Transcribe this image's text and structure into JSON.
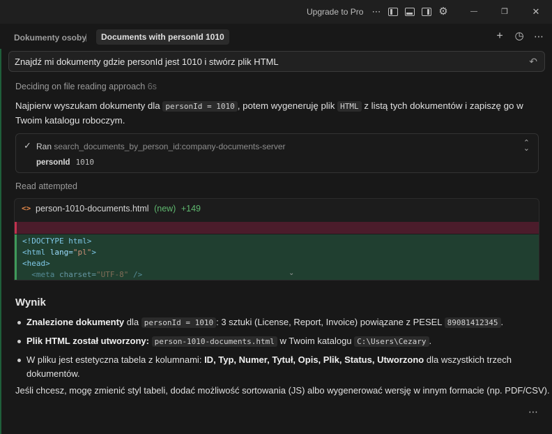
{
  "titlebar": {
    "upgrade_label": "Upgrade to Pro",
    "more_glyph": "⋯",
    "settings_glyph": "⚙",
    "minimize_glyph": "—",
    "restore_glyph": "❐",
    "close_glyph": "✕"
  },
  "header": {
    "tab_previous": "Dokumenty osoby",
    "tab_active": "Documents with personId 1010",
    "new_glyph": "+",
    "history_glyph": "◷",
    "more_glyph": "⋯"
  },
  "prompt": {
    "text": "Znajdź mi dokumenty gdzie personId jest 1010 i stwórz plik HTML",
    "undo_glyph": "↶"
  },
  "status": {
    "label": "Deciding on file reading approach",
    "time": "6s"
  },
  "intro": {
    "p1": "Najpierw wyszukam dokumenty dla",
    "code1": "personId = 1010",
    "p2": ", potem wygeneruję plik",
    "code2": "HTML",
    "p3": "z listą tych dokumentów i zapiszę go w Twoim katalogu roboczym."
  },
  "tool_call": {
    "check_glyph": "✓",
    "ran_label": "Ran",
    "tool_name": "search_documents_by_person_id:company-documents-server",
    "param_name": "personId",
    "param_value": "1010"
  },
  "read_attempted": "Read attempted",
  "file": {
    "icon_glyph": "<>",
    "name": "person-1010-documents.html",
    "status": "(new)",
    "additions": "+149",
    "lines": [
      {
        "tag": "<!DOCTYPE html>"
      },
      {
        "open": "<html ",
        "attr": "lang=",
        "val": "\"pl\"",
        "close": ">"
      },
      {
        "tag": "<head>"
      },
      {
        "open": "  <meta ",
        "attr": "charset=",
        "val": "\"UTF-8\"",
        "close": " />"
      }
    ],
    "chevron_glyph": "⌄"
  },
  "result": {
    "heading": "Wynik",
    "b1_bold": "Znalezione dokumenty",
    "b1_t1": "dla",
    "b1_code": "personId = 1010",
    "b1_t2": ": 3 sztuki (License, Report, Invoice) powiązane z PESEL",
    "b1_code2": "89081412345",
    "b1_t3": ".",
    "b2_bold": "Plik HTML został utworzony:",
    "b2_code": "person-1010-documents.html",
    "b2_t1": "w Twoim katalogu",
    "b2_code2": "C:\\Users\\Cezary",
    "b2_t2": ".",
    "b3_t1": "W pliku jest estetyczna tabela z kolumnami:",
    "b3_bold": "ID, Typ, Numer, Tytuł, Opis, Plik, Status, Utworzono",
    "b3_t2": "dla wszystkich trzech dokumentów.",
    "final": "Jeśli chcesz, mogę zmienić styl tabeli, dodać możliwość sortowania (JS) albo wygenerować wersję w innym formacie (np. PDF/CSV).",
    "more_glyph": "⋯"
  }
}
